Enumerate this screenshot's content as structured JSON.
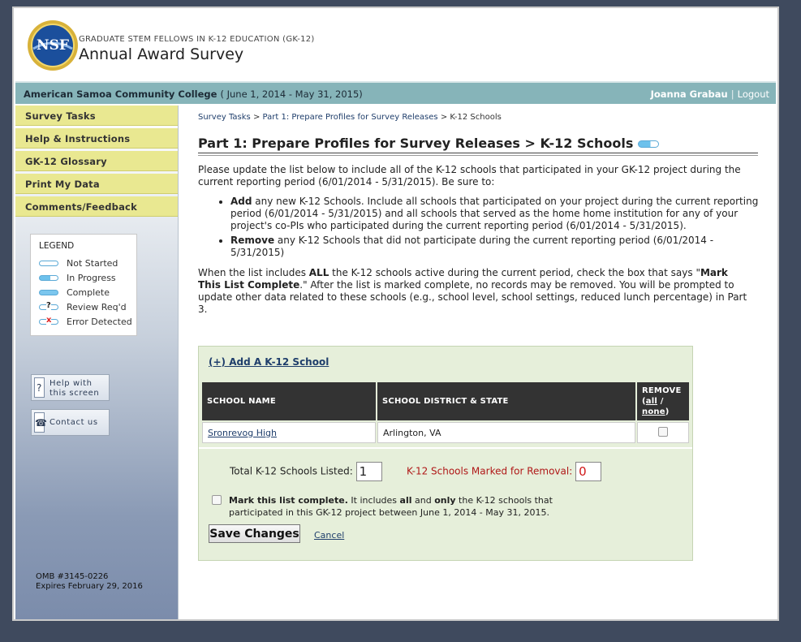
{
  "header": {
    "subtitle": "GRADUATE STEM FELLOWS IN K-12 EDUCATION (GK-12)",
    "title": "Annual Award Survey",
    "logo_text": "NSF"
  },
  "topbar": {
    "institution": "American Samoa Community College",
    "period": "( June 1, 2014 - May 31, 2015)",
    "user": "Joanna Grabau",
    "separator": "|",
    "logout": "Logout"
  },
  "sidebar": {
    "nav": [
      {
        "label": "Survey Tasks"
      },
      {
        "label": "Help & Instructions"
      },
      {
        "label": "GK-12 Glossary"
      },
      {
        "label": "Print My Data"
      },
      {
        "label": "Comments/Feedback"
      }
    ],
    "legend": {
      "title": "LEGEND",
      "items": [
        {
          "label": "Not Started",
          "icon": "status-not-started-icon"
        },
        {
          "label": "In Progress",
          "icon": "status-in-progress-icon"
        },
        {
          "label": "Complete",
          "icon": "status-complete-icon"
        },
        {
          "label": "Review Req'd",
          "icon": "status-review-icon",
          "mark": "?"
        },
        {
          "label": "Error Detected",
          "icon": "status-error-icon",
          "mark": "x"
        }
      ]
    },
    "help_button": {
      "line1": "Help with",
      "line2": "this screen",
      "glyph": "?"
    },
    "contact_button": {
      "label": "Contact us",
      "glyph": "☎"
    },
    "omb": {
      "line1": "OMB #3145-0226",
      "line2": "Expires February 29, 2016"
    }
  },
  "main": {
    "breadcrumb": {
      "crumb1": "Survey Tasks",
      "sep": ">",
      "crumb2": "Part 1: Prepare Profiles for Survey Releases",
      "current": "K-12 Schools"
    },
    "heading": "Part 1: Prepare Profiles for Survey Releases > K-12 Schools",
    "intro": "Please update the list below to include all of the K-12 schools that participated in your GK-12 project during the current reporting period (6/01/2014 - 5/31/2015). Be sure to:",
    "bullets": [
      {
        "bold": "Add",
        "text": " any new K-12 Schools. Include all schools that participated on your project during the current reporting period (6/01/2014 - 5/31/2015) and all schools that served as the home home institution for any of your project's co-PIs who participated during the current reporting period (6/01/2014 - 5/31/2015)."
      },
      {
        "bold": "Remove",
        "text": " any K-12 Schools that did not participate during the current reporting period (6/01/2014 - 5/31/2015)"
      }
    ],
    "para2": {
      "pre": "When the list includes ",
      "all": "ALL",
      "mid": " the K-12 schools active during the current period, check the box that says \"",
      "mark": "Mark This List Complete",
      "post": ".\" After the list is marked complete, no records may be removed. You will be prompted to update other data related to these schools (e.g., school level, school settings, reduced lunch percentage) in Part 3."
    }
  },
  "panel": {
    "add_link": "(+) Add A K-12 School",
    "columns": {
      "name": "SCHOOL NAME",
      "district": "SCHOOL DISTRICT & STATE",
      "remove": "REMOVE",
      "all": "all",
      "slash": "/",
      "none": "none"
    },
    "rows": [
      {
        "name": "Sronrevog High",
        "district": "Arlington, VA",
        "remove": false
      }
    ],
    "total_label": "Total K-12 Schools Listed:",
    "total_value": "1",
    "removal_label": "K-12 Schools Marked for Removal:",
    "removal_value": "0",
    "complete": {
      "bold": "Mark this list complete.",
      "t1": " It includes ",
      "all": "all",
      "t2": " and ",
      "only": "only",
      "t3": " the K-12 schools that participated in this GK-12 project between June 1, 2014 - May 31, 2015."
    },
    "save_label": "Save Changes",
    "cancel_label": "Cancel"
  }
}
